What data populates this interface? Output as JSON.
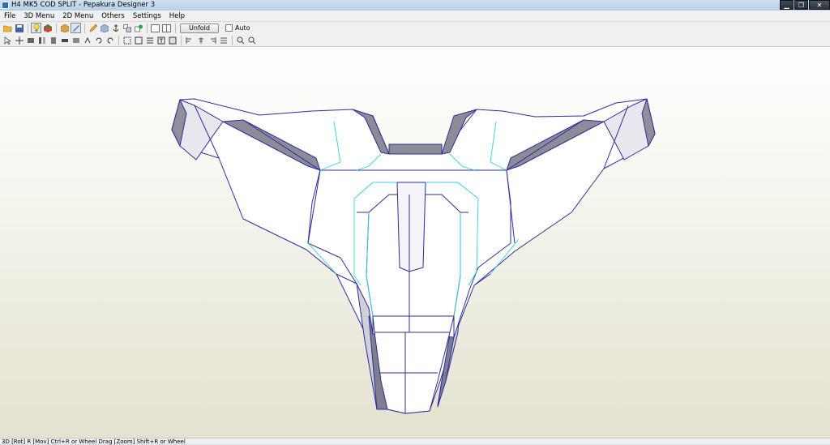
{
  "window": {
    "title": "H4 MK5 COD SPLIT - Pepakura Designer 3",
    "minimize": "▁",
    "maximize": "❐",
    "close": "✕"
  },
  "menu": [
    "File",
    "3D Menu",
    "2D Menu",
    "Others",
    "Settings",
    "Help"
  ],
  "toolbar1": {
    "icons": [
      "open-folder-icon",
      "save-icon",
      "light-bulb-icon",
      "texture-icon",
      "cube-icon",
      "edit-3d-icon",
      "draw-pencil-icon",
      "box-icon",
      "anchor-icon",
      "join-faces-icon",
      "color-fill-icon",
      "single-view-icon",
      "split-view-icon"
    ],
    "unfold_label": "Unfold",
    "auto_label": "Auto"
  },
  "toolbar2": {
    "icons": [
      "select-icon",
      "move-icon",
      "rotate-part-icon",
      "flip-icon",
      "scale-icon",
      "align-icon",
      "cut-icon",
      "join-icon",
      "undo-rotate-icon",
      "redo-rotate-icon",
      "add-flap-icon",
      "remove-flap-icon",
      "crease-icon",
      "text-icon",
      "grid-icon",
      "align-left-icon",
      "align-center-icon",
      "align-right-icon",
      "distribute-icon",
      "zoom-in-icon",
      "zoom-out-icon"
    ]
  },
  "status": {
    "text": "3D [Rot] R [Mov] Ctrl+R or Wheel Drag [Zoom] Shift+R or Wheel"
  },
  "colors": {
    "model_edge": "#2e2e9c",
    "fold_line": "#2fd1e0",
    "face_white": "#ffffff",
    "face_shade": "#9a9aa6"
  }
}
